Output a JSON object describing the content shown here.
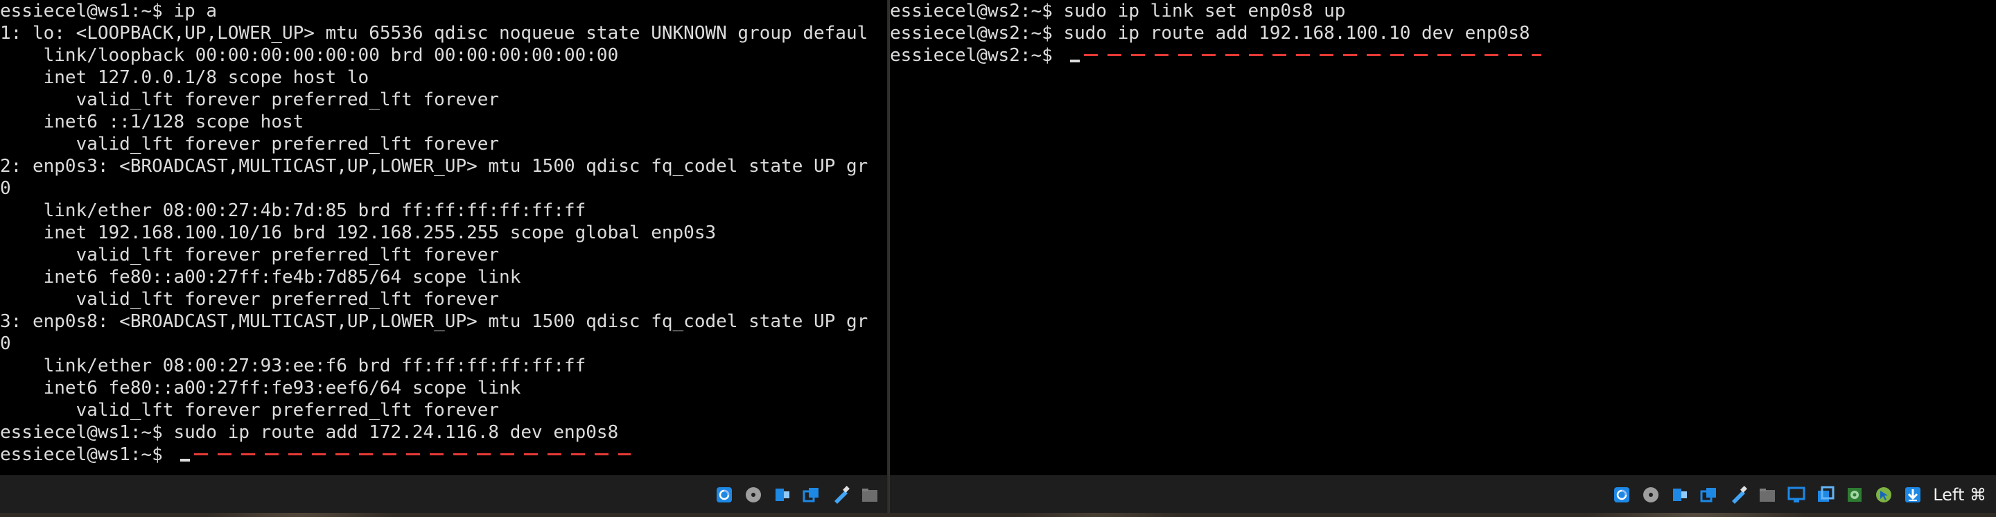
{
  "vm1": {
    "terminal_lines": [
      "essiecel@ws1:~$ ip a",
      "1: lo: <LOOPBACK,UP,LOWER_UP> mtu 65536 qdisc noqueue state UNKNOWN group defaul",
      "    link/loopback 00:00:00:00:00:00 brd 00:00:00:00:00:00",
      "    inet 127.0.0.1/8 scope host lo",
      "       valid_lft forever preferred_lft forever",
      "    inet6 ::1/128 scope host",
      "       valid_lft forever preferred_lft forever",
      "2: enp0s3: <BROADCAST,MULTICAST,UP,LOWER_UP> mtu 1500 qdisc fq_codel state UP gr",
      "0",
      "    link/ether 08:00:27:4b:7d:85 brd ff:ff:ff:ff:ff:ff",
      "    inet 192.168.100.10/16 brd 192.168.255.255 scope global enp0s3",
      "       valid_lft forever preferred_lft forever",
      "    inet6 fe80::a00:27ff:fe4b:7d85/64 scope link",
      "       valid_lft forever preferred_lft forever",
      "3: enp0s8: <BROADCAST,MULTICAST,UP,LOWER_UP> mtu 1500 qdisc fq_codel state UP gr",
      "0",
      "    link/ether 08:00:27:93:ee:f6 brd ff:ff:ff:ff:ff:ff",
      "    inet6 fe80::a00:27ff:fe93:eef6/64 scope link",
      "       valid_lft forever preferred_lft forever",
      "essiecel@ws1:~$ sudo ip route add 172.24.116.8 dev enp0s8"
    ],
    "prompt": "essiecel@ws1:~$ ",
    "statusbar_icons": [
      "hard-disk-icon",
      "optical-disk-icon",
      "audio-icon",
      "network-icon",
      "usb-icon",
      "shared-folder-icon"
    ]
  },
  "vm2": {
    "terminal_lines": [
      "essiecel@ws2:~$ sudo ip link set enp0s8 up",
      "essiecel@ws2:~$ sudo ip route add 192.168.100.10 dev enp0s8"
    ],
    "prompt": "essiecel@ws2:~$ ",
    "statusbar_icons": [
      "hard-disk-icon",
      "optical-disk-icon",
      "audio-icon",
      "network-icon",
      "usb-icon",
      "shared-folder-icon",
      "display-icon",
      "screen-capture-icon",
      "recording-icon",
      "mouse-integration-icon",
      "download-icon"
    ],
    "host_key": "Left ⌘"
  },
  "colors": {
    "terminal_bg": "#000000",
    "terminal_fg": "#dcdcdc",
    "annotation_dash": "#e53935",
    "statusbar_bg": "#1e1e1e"
  }
}
